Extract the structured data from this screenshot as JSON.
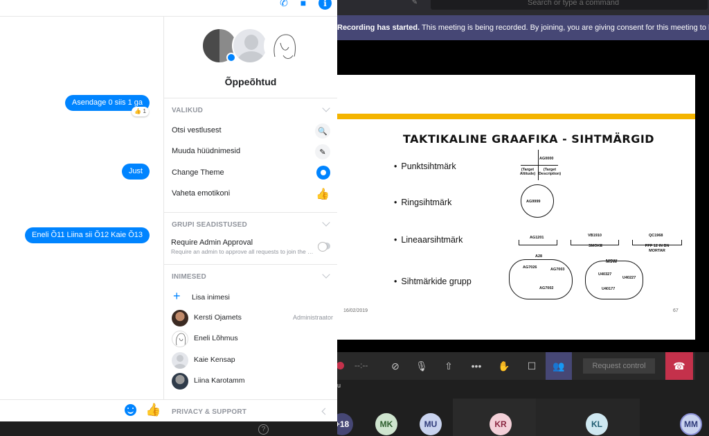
{
  "teams": {
    "search_placeholder": "Search or type a command",
    "recording_banner": {
      "bold": "Recording has started.",
      "text": " This meeting is being recorded. By joining, you are giving consent for this meeting to be r"
    },
    "slide": {
      "title": "TAKTIKALINE GRAAFIKA - SIHTMÄRGID",
      "bullets": [
        "Punktsihtmärk",
        "Ringsihtmärk",
        "Lineaarsihtmärk",
        "Sihtmärkide grupp"
      ],
      "date": "16/02/2019",
      "page": "67",
      "labels": {
        "point_id": "AG0000",
        "target_altitude": "(Target Altitude)",
        "target_description": "(Target Description)",
        "circle_id": "AG9999",
        "line1": "AG1201",
        "line2": "VB1910",
        "line2_sub": "SMOKE",
        "line3": "QC1968",
        "line3_sub": "PPF 12 IN BN MORTAR",
        "group1": "A28",
        "group1_a": "AG7026",
        "group1_b": "AG7003",
        "group1_c": "AG7002",
        "group2": "M9W",
        "group2_a": "U40327",
        "group2_b": "U40227",
        "group2_c": "U40177"
      }
    },
    "callbar": {
      "timer": "--:--",
      "request_control": "Request control"
    },
    "participants": [
      {
        "initials": "+18",
        "bg": "#464775",
        "fg": "#ffffff"
      },
      {
        "initials": "MK",
        "bg": "#cfe5cf",
        "fg": "#2e5e2e"
      },
      {
        "initials": "MU",
        "bg": "#c9d3ef",
        "fg": "#2f3b7a"
      },
      {
        "initials": "KR",
        "bg": "#f3d0d8",
        "fg": "#8a2640"
      },
      {
        "initials": "KL",
        "bg": "#cfe8f1",
        "fg": "#1f5c72"
      },
      {
        "initials": "MM",
        "bg": "#c9d3ef",
        "fg": "#2f3b7a"
      }
    ]
  },
  "messenger": {
    "messages": [
      {
        "text": "Asendage 0 siis 1 ga",
        "reaction": "👍 1"
      },
      {
        "text": "Just"
      },
      {
        "text": "Eneli Õ11 Liina sii Õ12 Kaie Õ13"
      }
    ],
    "group_name": "Õppeõhtud",
    "sections": {
      "options": "VALIKUD",
      "group_settings": "GRUPI SEADISTUSED",
      "people": "INIMESED",
      "privacy": "PRIVACY & SUPPORT"
    },
    "options": [
      {
        "label": "Otsi vestlusest",
        "icon": "search-icon"
      },
      {
        "label": "Muuda hüüdnimesid",
        "icon": "pencil-icon"
      },
      {
        "label": "Change Theme",
        "icon": "theme-icon"
      },
      {
        "label": "Vaheta emotikoni",
        "icon": "thumbs-up-icon"
      }
    ],
    "admin": {
      "label": "Require Admin Approval",
      "sub": "Require an admin to approve all requests to join the gro..."
    },
    "add_person": "Lisa inimesi",
    "people": [
      {
        "name": "Kersti Ojamets",
        "role": "Administraator"
      },
      {
        "name": "Eneli Lõhmus",
        "role": ""
      },
      {
        "name": "Kaie Kensap",
        "role": ""
      },
      {
        "name": "Liina Karotamm",
        "role": ""
      }
    ],
    "accent": "#0084ff"
  }
}
